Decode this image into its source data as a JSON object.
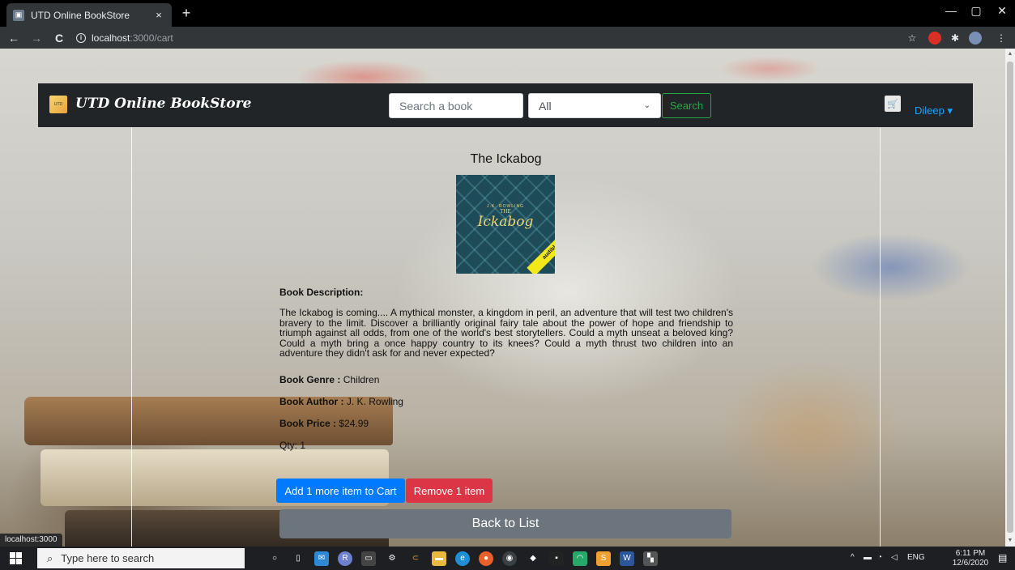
{
  "browser": {
    "tab_title": "UTD Online BookStore",
    "tab_close": "×",
    "new_tab": "+",
    "url_host": "localhost",
    "url_path": ":3000/cart",
    "status_url": "localhost:3000",
    "minimize": "—",
    "maximize": "▢",
    "close": "✕",
    "back": "←",
    "forward": "→",
    "reload": "C",
    "star": "☆",
    "menu": "⋮"
  },
  "navbar": {
    "brand": "UTD Online BookStore",
    "search_placeholder": "Search a book",
    "genre_selected": "All",
    "search_button": "Search",
    "user_name": "Dileep ▾"
  },
  "book": {
    "title": "The Ickabog",
    "cover": {
      "author": "J.K. ROWLING",
      "the": "THE",
      "title": "Ickabog",
      "badge": "audible"
    },
    "description_heading": "Book Description:",
    "description": "The Ickabog is coming.... A mythical monster, a kingdom in peril, an adventure that will test two children's bravery to the limit. Discover a brilliantly original fairy tale about the power of hope and friendship to triumph against all odds, from one of the world's best storytellers. Could a myth unseat a beloved king? Could a myth bring a once happy country to its knees? Could a myth thrust two children into an adventure they didn't ask for and never expected?",
    "genre_label": "Book Genre :",
    "genre_value": "Children",
    "author_label": "Book Author :",
    "author_value": "J. K. Rowling",
    "price_label": "Book Price :",
    "price_value": "$24.99",
    "qty": "Qty: 1"
  },
  "actions": {
    "add": "Add 1 more item to Cart",
    "remove": "Remove 1 item",
    "back": "Back to List"
  },
  "taskbar": {
    "search_placeholder": "Type here to search",
    "lang": "ENG",
    "time": "6:11 PM",
    "date": "12/6/2020"
  },
  "colors": {
    "primary": "#007bff",
    "danger": "#dc3545",
    "secondary": "#6c757d",
    "success": "#28a745",
    "navbar_bg": "#222527",
    "link": "#19a3ff"
  }
}
